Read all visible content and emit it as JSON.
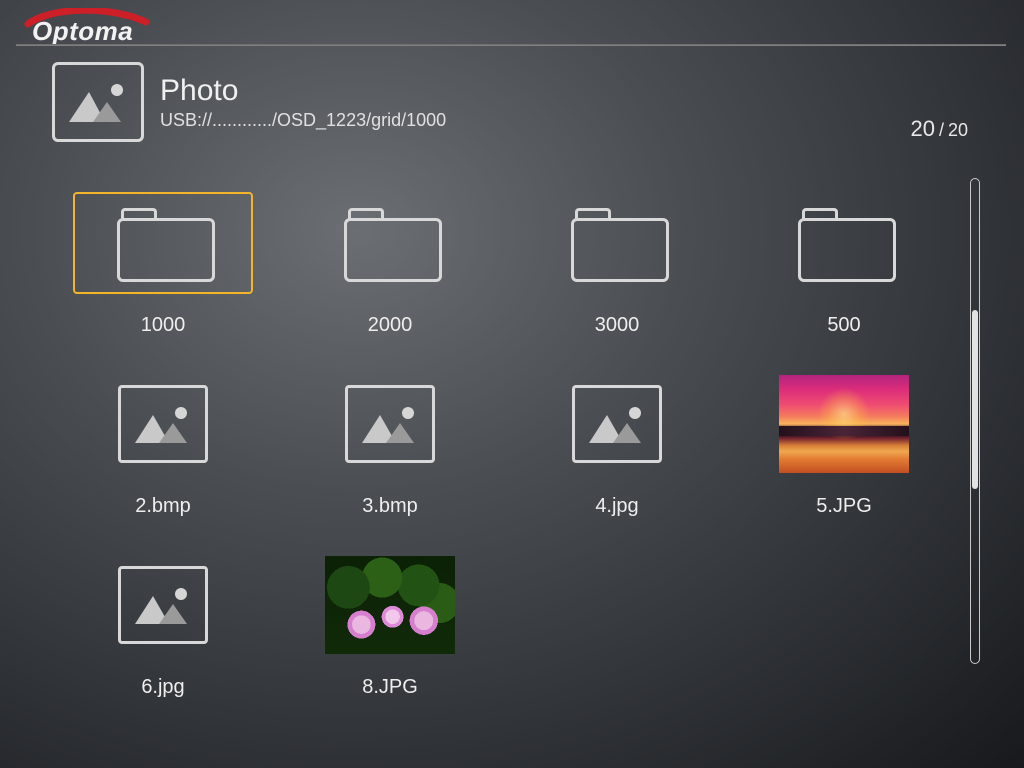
{
  "brand": "Optoma",
  "section": {
    "title": "Photo",
    "path": "USB://............/OSD_1223/grid/1000"
  },
  "pager": {
    "current": "20",
    "sep": "/",
    "total": "20"
  },
  "colors": {
    "accent": "#f2b52a"
  },
  "scrollbar": {
    "thumb_top_pct": 27,
    "thumb_height_pct": 37
  },
  "items": [
    {
      "name": "1000",
      "type": "folder",
      "selected": true
    },
    {
      "name": "2000",
      "type": "folder",
      "selected": false
    },
    {
      "name": "3000",
      "type": "folder",
      "selected": false
    },
    {
      "name": "500",
      "type": "folder",
      "selected": false
    },
    {
      "name": "2.bmp",
      "type": "image-placeholder",
      "selected": false
    },
    {
      "name": "3.bmp",
      "type": "image-placeholder",
      "selected": false
    },
    {
      "name": "4.jpg",
      "type": "image-placeholder",
      "selected": false
    },
    {
      "name": "5.JPG",
      "type": "image-thumb",
      "thumb": "sunset",
      "selected": false
    },
    {
      "name": "6.jpg",
      "type": "image-placeholder",
      "selected": false
    },
    {
      "name": "8.JPG",
      "type": "image-thumb",
      "thumb": "flowers",
      "selected": false
    }
  ]
}
